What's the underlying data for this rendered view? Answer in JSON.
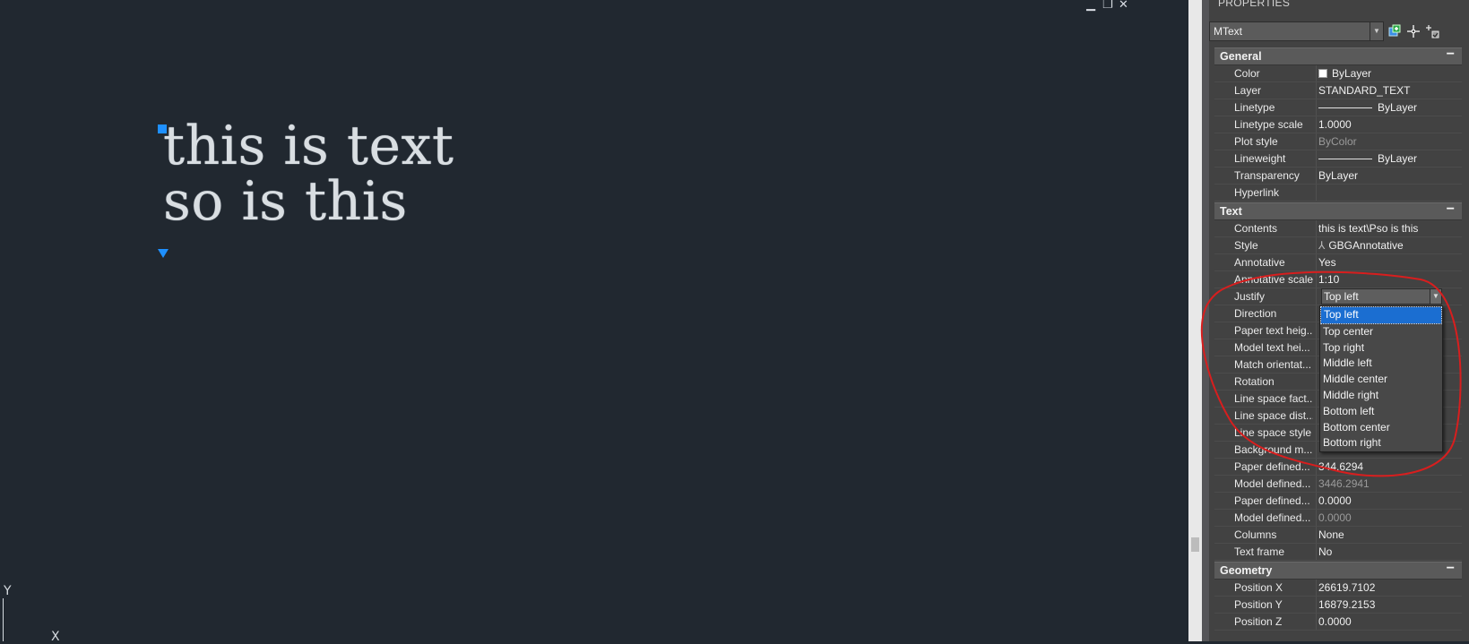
{
  "canvas": {
    "window_controls": [
      "▁",
      "❐",
      "✕"
    ],
    "mtext_lines": [
      "this is text",
      "so is this"
    ],
    "ucs": {
      "y_label": "Y",
      "x_label": "X"
    }
  },
  "palette": {
    "title": "PROPERTIES",
    "object_type": "MText",
    "sections": {
      "general": {
        "title": "General",
        "collapse": "−",
        "rows": [
          {
            "label": "Color",
            "value": "ByLayer"
          },
          {
            "label": "Layer",
            "value": "STANDARD_TEXT"
          },
          {
            "label": "Linetype",
            "value": "ByLayer"
          },
          {
            "label": "Linetype scale",
            "value": "1.0000"
          },
          {
            "label": "Plot style",
            "value": "ByColor"
          },
          {
            "label": "Lineweight",
            "value": "ByLayer"
          },
          {
            "label": "Transparency",
            "value": "ByLayer"
          },
          {
            "label": "Hyperlink",
            "value": ""
          }
        ]
      },
      "text": {
        "title": "Text",
        "collapse": "−",
        "rows": [
          {
            "label": "Contents",
            "value": "this is text\\Pso is this"
          },
          {
            "label": "Style",
            "value": "GBGAnnotative"
          },
          {
            "label": "Annotative",
            "value": "Yes"
          },
          {
            "label": "Annotative scale",
            "value": "1:10"
          },
          {
            "label": "Justify",
            "value": "Top left"
          },
          {
            "label": "Direction",
            "value": ""
          },
          {
            "label": "Paper text heig...",
            "value": ""
          },
          {
            "label": "Model text hei...",
            "value": ""
          },
          {
            "label": "Match orientat...",
            "value": ""
          },
          {
            "label": "Rotation",
            "value": ""
          },
          {
            "label": "Line space fact...",
            "value": ""
          },
          {
            "label": "Line space dist...",
            "value": ""
          },
          {
            "label": "Line space style",
            "value": ""
          },
          {
            "label": "Background m...",
            "value": ""
          },
          {
            "label": "Paper defined...",
            "value": "344.6294"
          },
          {
            "label": "Model defined...",
            "value": "3446.2941"
          },
          {
            "label": "Paper defined...",
            "value": "0.0000"
          },
          {
            "label": "Model defined...",
            "value": "0.0000"
          },
          {
            "label": "Columns",
            "value": "None"
          },
          {
            "label": "Text frame",
            "value": "No"
          }
        ]
      },
      "geometry": {
        "title": "Geometry",
        "collapse": "−",
        "rows": [
          {
            "label": "Position X",
            "value": "26619.7102"
          },
          {
            "label": "Position Y",
            "value": "16879.2153"
          },
          {
            "label": "Position Z",
            "value": "0.0000"
          }
        ]
      }
    },
    "justify_dropdown": {
      "selected": "Top left",
      "options": [
        "Top left",
        "Top center",
        "Top right",
        "Middle left",
        "Middle center",
        "Middle right",
        "Bottom left",
        "Bottom center",
        "Bottom right"
      ]
    }
  },
  "colors": {
    "canvas_bg": "#212830",
    "palette_bg": "#424242",
    "selection": "#1b6ed1",
    "grip": "#1e90ff",
    "annotation": "#d81e1e"
  },
  "icons": [
    "toggle-pickadd-icon",
    "select-objects-icon",
    "quick-select-icon"
  ]
}
